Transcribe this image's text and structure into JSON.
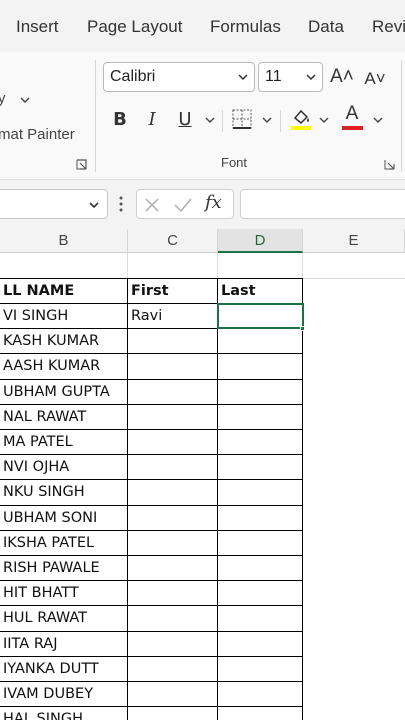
{
  "tabs": [
    "Insert",
    "Page Layout",
    "Formulas",
    "Data",
    "Revi"
  ],
  "clipboard": {
    "painter_label": "mat Painter"
  },
  "font_group": {
    "label": "Font",
    "font_name": "Calibri",
    "font_size": "11",
    "grow_icon": "A˄",
    "shrink_icon": "A˅",
    "bold": "B",
    "italic": "I",
    "underline": "U",
    "font_color_letter": "A"
  },
  "formula_bar": {
    "fx": "fx",
    "value": ""
  },
  "columns": [
    {
      "label": "B",
      "selected": false
    },
    {
      "label": "C",
      "selected": false
    },
    {
      "label": "D",
      "selected": true
    },
    {
      "label": "E",
      "selected": false
    }
  ],
  "headers": {
    "full_name": "LL NAME",
    "first": "First",
    "last": "Last"
  },
  "rows": [
    {
      "name": "VI SINGH",
      "first": "Ravi",
      "last": ""
    },
    {
      "name": "KASH KUMAR",
      "first": "",
      "last": ""
    },
    {
      "name": "AASH KUMAR",
      "first": "",
      "last": ""
    },
    {
      "name": "UBHAM GUPTA",
      "first": "",
      "last": ""
    },
    {
      "name": "NAL RAWAT",
      "first": "",
      "last": ""
    },
    {
      "name": "MA PATEL",
      "first": "",
      "last": ""
    },
    {
      "name": "NVI OJHA",
      "first": "",
      "last": ""
    },
    {
      "name": "NKU SINGH",
      "first": "",
      "last": ""
    },
    {
      "name": "UBHAM SONI",
      "first": "",
      "last": ""
    },
    {
      "name": "IKSHA PATEL",
      "first": "",
      "last": ""
    },
    {
      "name": "RISH PAWALE",
      "first": "",
      "last": ""
    },
    {
      "name": "HIT BHATT",
      "first": "",
      "last": ""
    },
    {
      "name": "HUL RAWAT",
      "first": "",
      "last": ""
    },
    {
      "name": "IITA RAJ",
      "first": "",
      "last": ""
    },
    {
      "name": "IYANKA DUTT",
      "first": "",
      "last": ""
    },
    {
      "name": "IVAM DUBEY",
      "first": "",
      "last": ""
    },
    {
      "name": "HAL SINGH",
      "first": "",
      "last": ""
    }
  ],
  "colors": {
    "accent_green": "#1e7145",
    "highlight_yellow": "#ffff00",
    "font_red": "#e02020"
  }
}
